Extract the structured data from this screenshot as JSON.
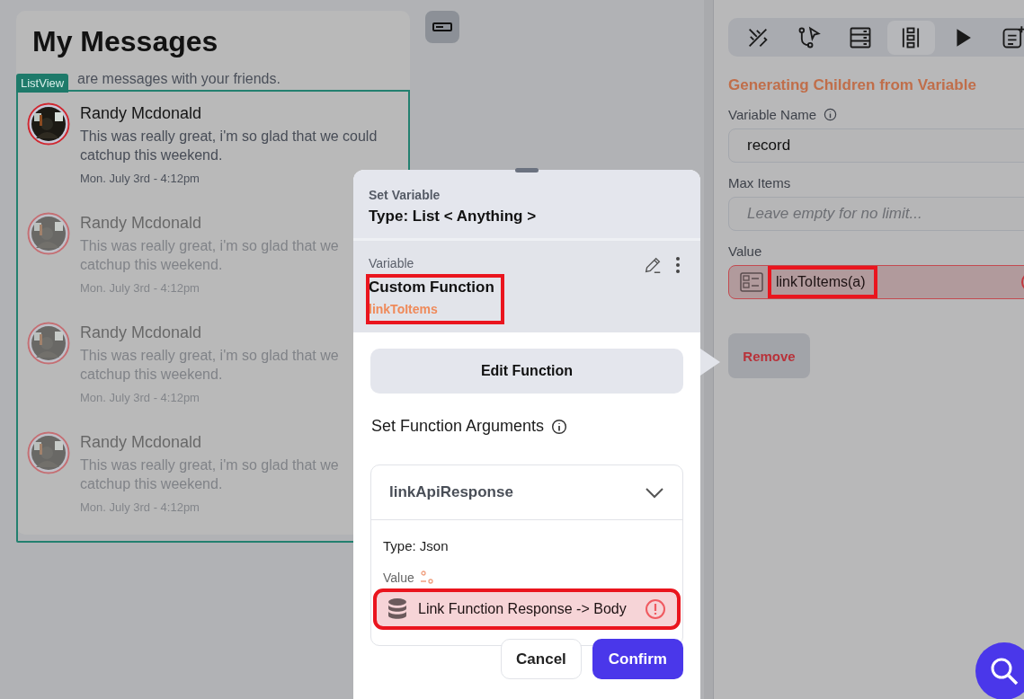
{
  "messages_card": {
    "title": "My Messages",
    "subtitle": "are messages with your friends.",
    "list_badge": "ListView",
    "messages": [
      {
        "name": "Randy Mcdonald",
        "text_lines": [
          "This was really great, i'm so glad that we could",
          "catchup this weekend."
        ],
        "time": "Mon. July 3rd - 4:12pm",
        "dimmed": false
      },
      {
        "name": "Randy Mcdonald",
        "text_lines": [
          "This was really great, i'm so glad that we",
          "catchup this weekend."
        ],
        "time": "Mon. July 3rd - 4:12pm",
        "dimmed": true
      },
      {
        "name": "Randy Mcdonald",
        "text_lines": [
          "This was really great, i'm so glad that we",
          "catchup this weekend."
        ],
        "time": "Mon. July 3rd - 4:12pm",
        "dimmed": true
      },
      {
        "name": "Randy Mcdonald",
        "text_lines": [
          "This was really great, i'm so glad that we",
          "catchup this weekend."
        ],
        "time": "Mon. July 3rd - 4:12pm",
        "dimmed": true
      }
    ]
  },
  "properties_panel": {
    "tabs": [
      {
        "kind": "design",
        "selected": false
      },
      {
        "kind": "actions",
        "selected": false
      },
      {
        "kind": "backend",
        "selected": false
      },
      {
        "kind": "children",
        "selected": true
      },
      {
        "kind": "play",
        "selected": false
      },
      {
        "kind": "notes",
        "selected": false
      }
    ],
    "heading": "Generating Children from Variable",
    "variable_name": {
      "label": "Variable Name",
      "value": "record"
    },
    "max_items": {
      "label": "Max Items",
      "placeholder": "Leave empty for no limit..."
    },
    "value": {
      "label": "Value",
      "chip": "linkToItems(a)",
      "error": true,
      "highlighted": true
    },
    "remove_button": "Remove"
  },
  "popup": {
    "subtitle": "Set Variable",
    "title": "Type: List < Anything >",
    "variable": {
      "label": "Variable",
      "name": "Custom Function",
      "function": "linkToItems",
      "highlighted": true
    },
    "edit_button": "Edit Function",
    "arguments_title": "Set Function Arguments",
    "argument": {
      "name": "linkApiResponse",
      "expanded": true,
      "type": "Type: Json",
      "value_label": "Value",
      "value": "Link Function Response -> Body",
      "error": true,
      "highlighted": true
    },
    "buttons": [
      {
        "label": "Cancel",
        "kind": "secondary"
      },
      {
        "label": "Confirm",
        "kind": "primary"
      }
    ]
  }
}
